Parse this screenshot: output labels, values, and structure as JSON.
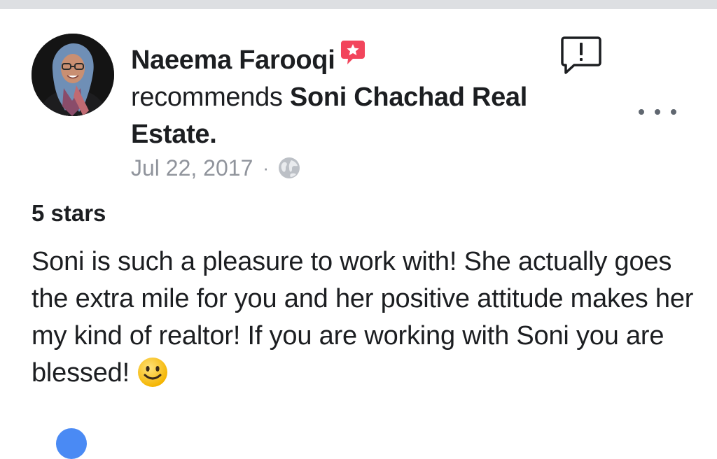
{
  "post": {
    "author": "Naeema Farooqi",
    "verb": "recommends",
    "page": "Soni Chachad Real Estate.",
    "date": "Jul 22, 2017",
    "separator": "·",
    "audience_icon": "globe-icon",
    "rating": "5 stars",
    "review_text": "Soni is such a pleasure to work with! She actually goes the extra mile for you and her positive attitude makes her my kind of realtor! If you are working with Soni you are blessed!",
    "emoji": "slightly-smiling-face"
  },
  "icons": {
    "badge": "recommendation-star-badge-icon",
    "report": "report-flag-icon",
    "more": "more-options-icon"
  },
  "colors": {
    "badge_red": "#f2455c",
    "meta_gray": "#90949c",
    "text": "#1c1e21",
    "top_strip": "#dddfe2",
    "reaction_blue": "#4a8af4"
  }
}
